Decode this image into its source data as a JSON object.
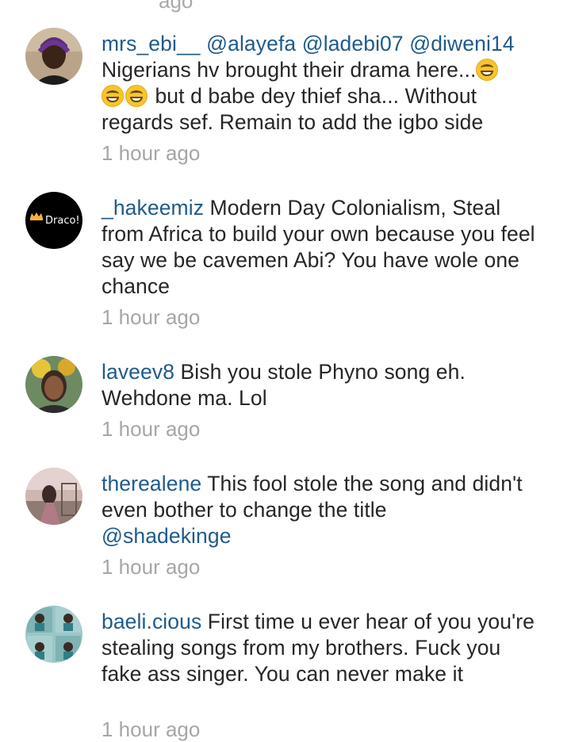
{
  "comments": [
    {
      "username": "mrs_ebi__",
      "mentions": [
        "@alayefa",
        "@ladebi07",
        "@diweni14"
      ],
      "text_line1": "Nigerians hv brought their drama here...",
      "text_line2": "but d babe dey thief sha... Without",
      "text_line3": "regards sef. Remain to add the igbo side",
      "emoji": "face-with-tears-of-joy-icon",
      "time": "1 hour ago"
    },
    {
      "username": "_hakeemiz",
      "text": "Modern Day Colonialism, Steal from Africa to build your own because you feel say we be cavemen Abi? You have wole one chance",
      "avatar_label": "Draco!",
      "time": "1 hour ago"
    },
    {
      "username": "laveev8",
      "text": "Bish you stole Phyno song eh. Wehdone ma. Lol",
      "time": "1 hour ago"
    },
    {
      "username": "therealene",
      "text": "This fool stole the song and didn't even bother to change the title",
      "mention": "@shadekinge",
      "time": "1 hour ago"
    },
    {
      "username": "baeli.cious",
      "text": "First time u ever hear of you you're stealing songs from my brothers. Fuck you fake ass singer. You can never make it",
      "time": "1 hour ago"
    }
  ]
}
